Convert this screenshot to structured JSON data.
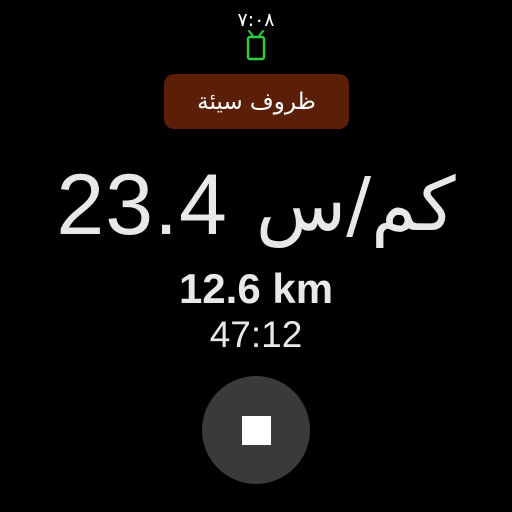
{
  "status_bar": {
    "time": "٧:٠٨",
    "connection_icon": "phone-icon",
    "connection_color": "#2ecc40"
  },
  "warning_badge": {
    "label": "ظروف سيئة",
    "background_color": "#5b1f08"
  },
  "workout": {
    "speed_value": "23.4",
    "speed_unit": "كم/س",
    "distance": "12.6 km",
    "duration": "47:12"
  },
  "controls": {
    "stop_icon": "stop-icon"
  }
}
